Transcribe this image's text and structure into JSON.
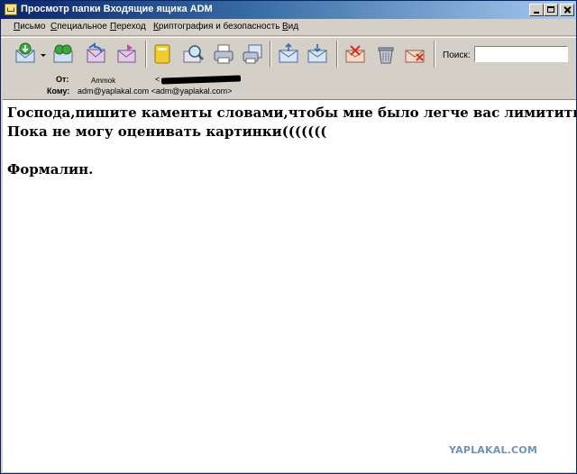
{
  "window": {
    "title": "Просмотр папки Входящие ящика ADM"
  },
  "menu": {
    "items": [
      {
        "label": "Письмо",
        "key": "П"
      },
      {
        "label": "Специальное",
        "key": "С"
      },
      {
        "label": "Переход",
        "key": "П"
      },
      {
        "label": "Криптография и безопасность",
        "key": "К"
      },
      {
        "label": "Вид",
        "key": "В"
      }
    ]
  },
  "toolbar": {
    "buttons": [
      "get-mail-icon",
      "send-receive-icon",
      "reply-icon",
      "forward-icon",
      "address-book-icon",
      "find-icon",
      "print-icon",
      "print-preview-icon",
      "move-to-folder-icon",
      "copy-to-folder-icon",
      "mark-spam-icon",
      "trash-icon",
      "delete-icon"
    ],
    "search_label": "Поиск:",
    "search_value": ""
  },
  "header": {
    "from_label": "От:",
    "from_name": "Ammok",
    "from_email_prefix": "<",
    "to_label": "Кому:",
    "to_value": "adm@yaplakal.com <adm@yaplakal.com>"
  },
  "message": {
    "lines": [
      "Господа,пишите каменты словами,чтобы мне было легче вас лимитить.",
      "Пока не могу оценивать картинки(((((((",
      "Формалин."
    ]
  },
  "watermark": "YAPLAKAL.COM",
  "colors": {
    "title_gradient_start": "#0a246a",
    "title_gradient_end": "#a6caf0",
    "chrome": "#d4d0c8",
    "watermark": "#6f93b8"
  }
}
